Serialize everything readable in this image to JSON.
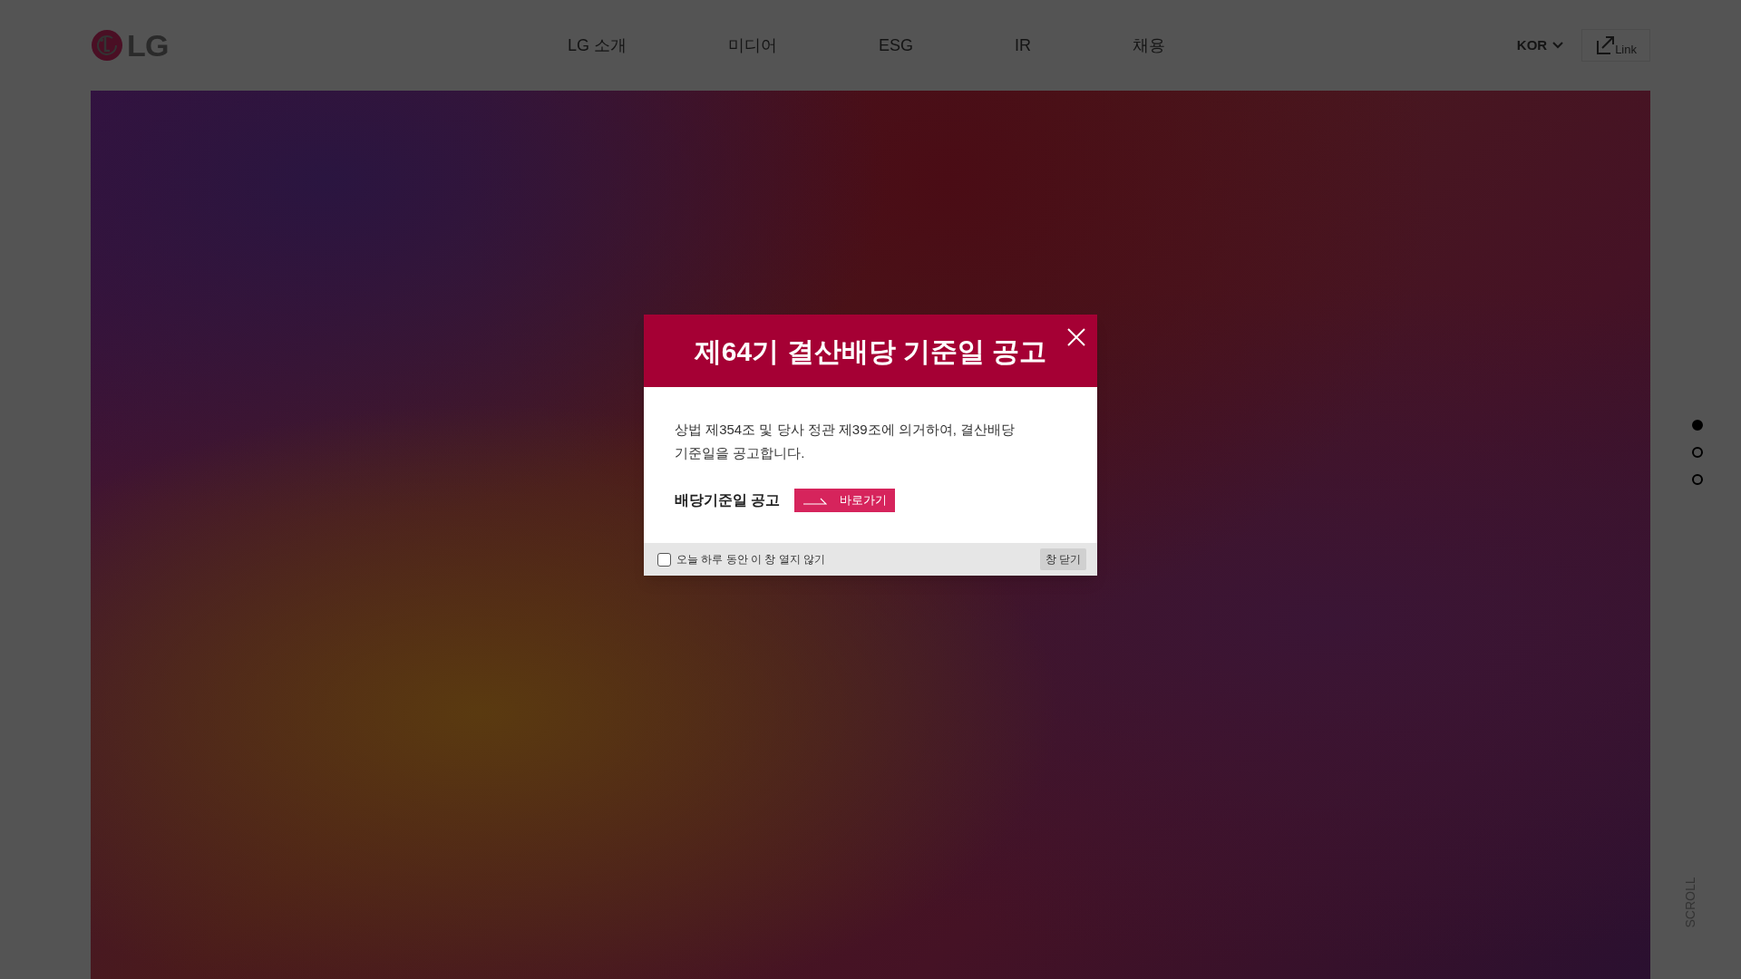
{
  "header": {
    "logo": "LG",
    "nav": [
      "LG 소개",
      "미디어",
      "ESG",
      "IR",
      "채용"
    ],
    "language": "KOR",
    "link_label": "Link"
  },
  "slide_dots": [
    {
      "selected": true
    },
    {
      "selected": false
    },
    {
      "selected": false
    }
  ],
  "scroll_label": "SCROLL",
  "popup": {
    "title": "제64기 결산배당 기준일 공고",
    "body": "상법 제354조 및 당사 정관 제39조에 의거하여, 결산배당 기준일을 공고합니다.",
    "link_label": "배당기준일 공고",
    "link_button": "바로가기",
    "dont_show_today": {
      "label": "오늘 하루 동안 이 창 열지 않기",
      "checked": false
    },
    "close_button": "창 닫기"
  }
}
